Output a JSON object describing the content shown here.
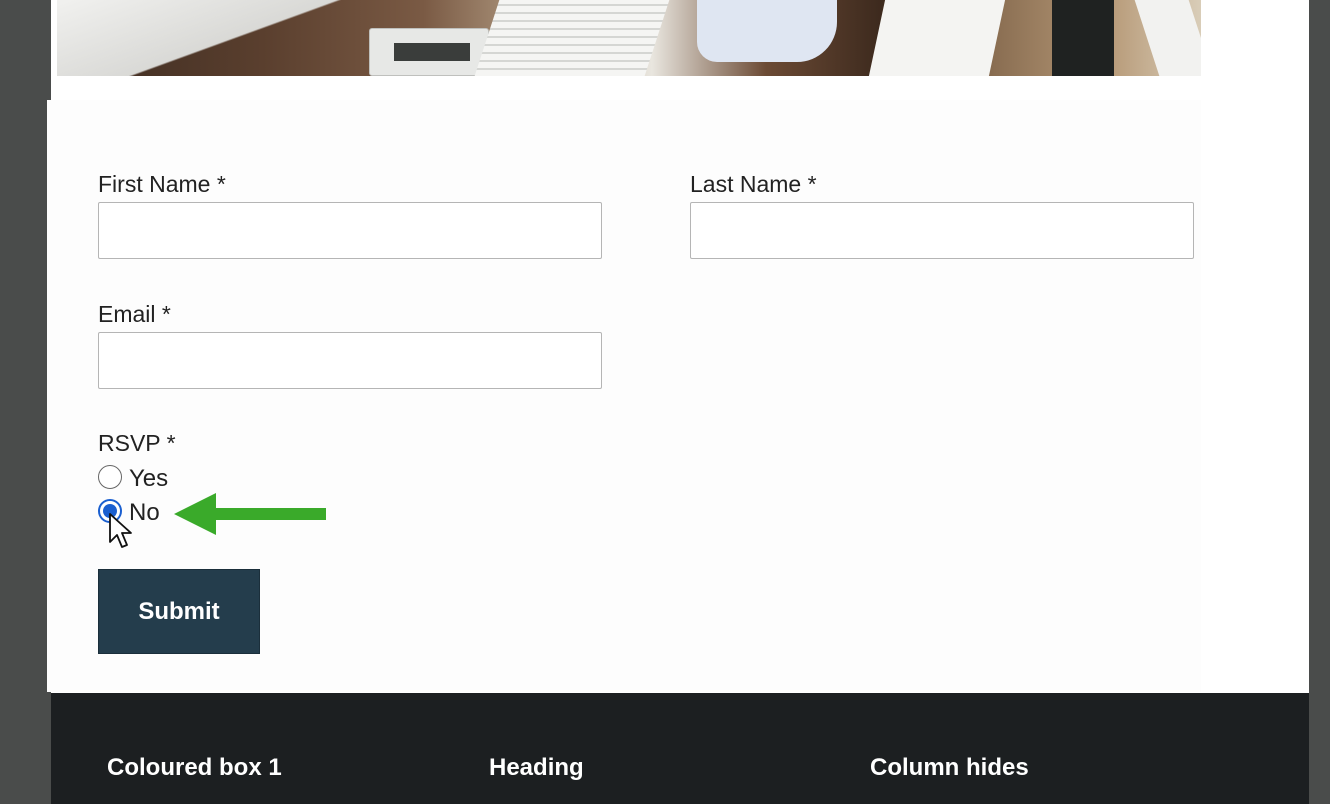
{
  "form": {
    "first_name": {
      "label": "First Name *",
      "value": "",
      "placeholder": ""
    },
    "last_name": {
      "label": "Last Name *",
      "value": "",
      "placeholder": ""
    },
    "email": {
      "label": "Email *",
      "value": "",
      "placeholder": ""
    },
    "rsvp": {
      "label": "RSVP *",
      "options": [
        {
          "label": "Yes",
          "checked": false
        },
        {
          "label": "No",
          "checked": true
        }
      ]
    },
    "submit_label": "Submit"
  },
  "footer": {
    "columns": [
      {
        "heading": "Coloured box 1"
      },
      {
        "heading": "Heading"
      },
      {
        "heading": "Column hides"
      }
    ]
  },
  "colors": {
    "background": "#4a4c4b",
    "submit_button": "#243d4c",
    "footer": "#1c1f21",
    "radio_accent": "#1a5fd0",
    "annotation_arrow": "#3aaa2a"
  },
  "icons": {
    "annotation": "green-arrow-left-icon",
    "pointer": "mouse-cursor-icon"
  }
}
